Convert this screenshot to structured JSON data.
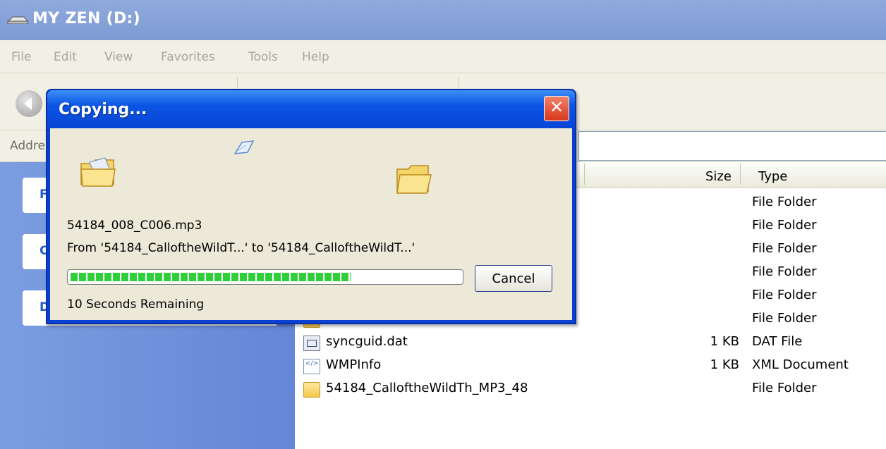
{
  "window": {
    "title": "MY ZEN (D:)"
  },
  "menu": [
    "File",
    "Edit",
    "View",
    "Favorites",
    "Tools",
    "Help"
  ],
  "address": {
    "label": "Addre"
  },
  "left_pane": {
    "task_letters": [
      "F",
      "C",
      "D"
    ]
  },
  "columns": {
    "size": "Size",
    "type": "Type"
  },
  "files": [
    {
      "name": "",
      "size": "",
      "type": "File Folder",
      "icon": "folder-icon"
    },
    {
      "name": "",
      "size": "",
      "type": "File Folder",
      "icon": "folder-icon"
    },
    {
      "name": "",
      "size": "",
      "type": "File Folder",
      "icon": "folder-icon"
    },
    {
      "name": "",
      "size": "",
      "type": "File Folder",
      "icon": "folder-icon"
    },
    {
      "name": "",
      "size": "",
      "type": "File Folder",
      "icon": "folder-icon"
    },
    {
      "name": "",
      "size": "",
      "type": "File Folder",
      "icon": "folder-icon"
    },
    {
      "name": "syncguid.dat",
      "size": "1 KB",
      "type": "DAT File",
      "icon": "dat-file-icon"
    },
    {
      "name": "WMPInfo",
      "size": "1 KB",
      "type": "XML Document",
      "icon": "xml-file-icon"
    },
    {
      "name": "54184_CalloftheWildTh_MP3_48",
      "size": "",
      "type": "File Folder",
      "icon": "folder-icon"
    }
  ],
  "dialog": {
    "title": "Copying...",
    "close_label": "✕",
    "file_name": "54184_008_C006.mp3",
    "from_to": "From '54184_CalloftheWildT...' to '54184_CalloftheWildT...'",
    "progress": 0.72,
    "remaining": "10 Seconds Remaining",
    "cancel_label": "Cancel"
  },
  "colors": {
    "titlebar": "#7d9ad4",
    "dialog_title": "#0a54e3",
    "progress": "#2fcf3a",
    "left_pane": "#6f90da"
  }
}
